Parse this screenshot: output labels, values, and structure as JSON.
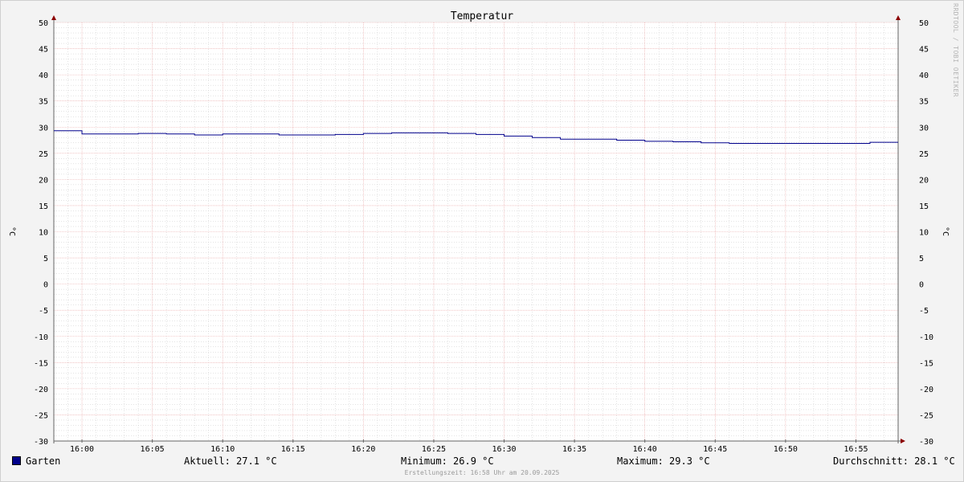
{
  "chart_data": {
    "type": "line",
    "title": "Temperatur",
    "ylabel": "°C",
    "ylim": [
      -30,
      50
    ],
    "y_ticks": [
      "50",
      "45",
      "40",
      "35",
      "30",
      "25",
      "20",
      "15",
      "10",
      "5",
      "0",
      "-5",
      "-10",
      "-15",
      "-20",
      "-25",
      "-30"
    ],
    "x_ticks": [
      "16:00",
      "16:05",
      "16:10",
      "16:15",
      "16:20",
      "16:25",
      "16:30",
      "16:35",
      "16:40",
      "16:45",
      "16:50",
      "16:55"
    ],
    "x_range": [
      "15:58",
      "17:58"
    ],
    "grid": true,
    "series": [
      {
        "name": "Garten",
        "color": "#00008b",
        "x": [
          "15:58",
          "16:00",
          "16:04",
          "16:06",
          "16:08",
          "16:10",
          "16:14",
          "16:18",
          "16:20",
          "16:22",
          "16:26",
          "16:28",
          "16:30",
          "16:32",
          "16:34",
          "16:38",
          "16:40",
          "16:42",
          "16:44",
          "16:46",
          "16:56",
          "16:58"
        ],
        "values": [
          29.3,
          28.7,
          28.8,
          28.7,
          28.5,
          28.7,
          28.5,
          28.6,
          28.8,
          28.9,
          28.8,
          28.6,
          28.3,
          28.0,
          27.7,
          27.5,
          27.3,
          27.2,
          27.0,
          26.9,
          27.1,
          27.1
        ]
      }
    ]
  },
  "legend": {
    "series_name": "Garten",
    "current": "Aktuell: 27.1 °C",
    "minimum": "Minimum: 26.9 °C",
    "maximum": "Maximum: 29.3 °C",
    "average": "Durchschnitt: 28.1 °C"
  },
  "footer": "Erstellungszeit: 16:58 Uhr am 20.09.2025",
  "watermark": "RRDTOOL / TOBI OETIKER",
  "colors": {
    "background": "#f3f3f3",
    "plot": "#ffffff",
    "major_grid": "#e8a0a0",
    "minor_grid": "#c8c8c8",
    "axis": "#666666",
    "arrow": "#8b0000",
    "line": "#00008b"
  }
}
